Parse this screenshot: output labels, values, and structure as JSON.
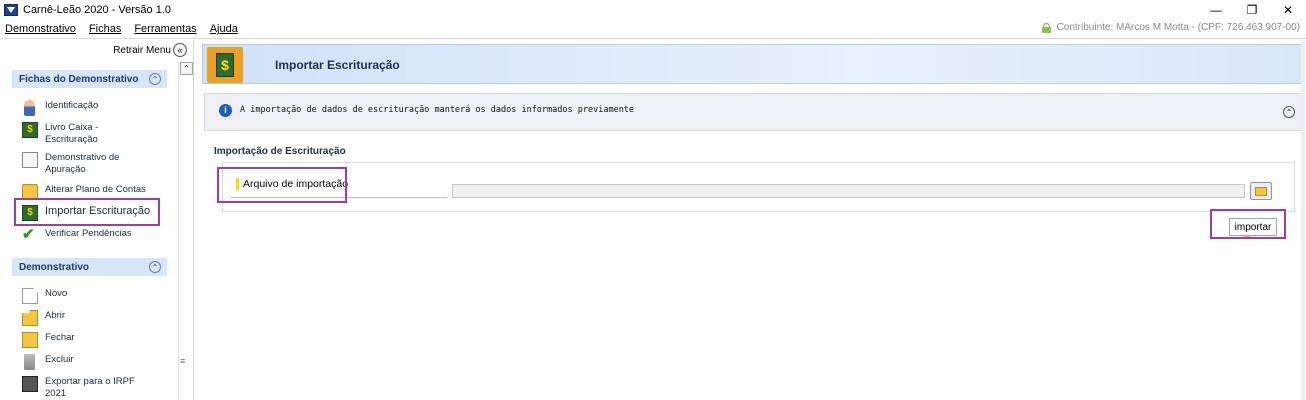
{
  "window": {
    "title": "Carnê-Leão 2020 - Versão 1.0",
    "controls": {
      "minimize": "—",
      "restore": "❐",
      "close": "✕"
    }
  },
  "menu": {
    "items": [
      "Demonstrativo",
      "Fichas",
      "Ferramentas",
      "Ajuda"
    ],
    "contributor": "Contribuinte: MArcos M Motta - (CPF: 726.463.907-00)"
  },
  "sidebar": {
    "retrair": "Retrair Menu",
    "retrair_icon": "«",
    "fichas": {
      "title": "Fichas do Demonstrativo",
      "collapse_icon": "⌃",
      "items": [
        {
          "label": "Identificação",
          "icon": "person-icon"
        },
        {
          "label": "Livro Caixa - Escrituração",
          "icon": "book-icon"
        },
        {
          "label": "Demonstrativo de Apuração",
          "icon": "document-icon"
        },
        {
          "label": "Alterar Plano de Contas",
          "icon": "folder-edit-icon"
        },
        {
          "label": "Importar Escrituração",
          "icon": "import-book-icon"
        },
        {
          "label": "Verificar Pendências",
          "icon": "check-icon"
        }
      ]
    },
    "demonstrativo": {
      "title": "Demonstrativo",
      "collapse_icon": "⌃",
      "items": [
        {
          "label": "Novo",
          "icon": "new-page-icon"
        },
        {
          "label": "Abrir",
          "icon": "open-folder-icon"
        },
        {
          "label": "Fechar",
          "icon": "folder-icon"
        },
        {
          "label": "Excluir",
          "icon": "trash-icon"
        },
        {
          "label": "Exportar para o IRPF 2021",
          "icon": "export-icon"
        }
      ]
    },
    "splitter": "≡",
    "scroll_up": "⌃"
  },
  "main": {
    "header": {
      "title": "Importar Escrituração",
      "icon_glyph": "$"
    },
    "info": {
      "icon": "i",
      "text": "A importação de dados de escrituração manterá os dados informados previamente",
      "collapse_icon": "⌃"
    },
    "section_title": "Importação de Escrituração",
    "form": {
      "file_label": "Arquivo de importação",
      "file_value": ""
    },
    "import_button": "importar"
  }
}
